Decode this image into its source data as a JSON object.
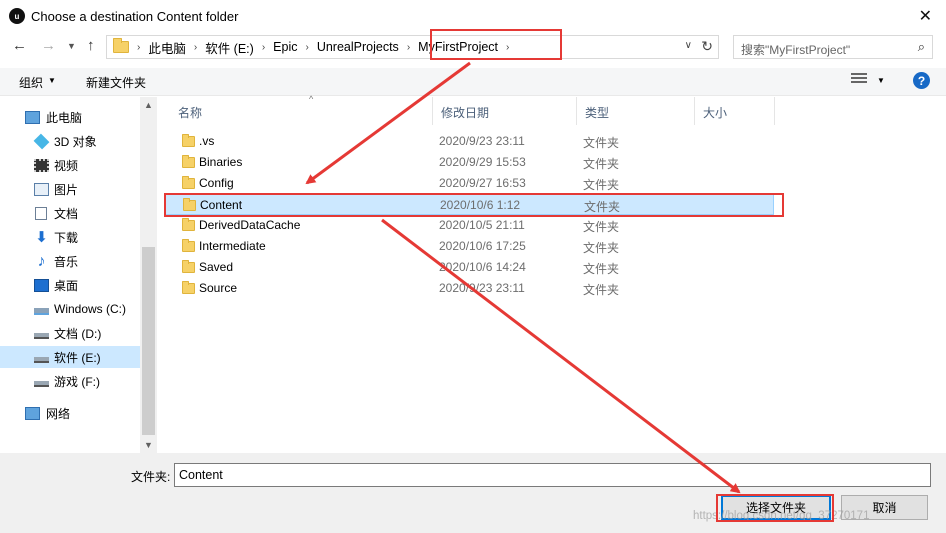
{
  "window": {
    "title": "Choose a destination Content folder",
    "logo": "unreal-engine-logo",
    "logo_text": "u"
  },
  "address": {
    "crumbs": [
      "此电脑",
      "软件 (E:)",
      "Epic",
      "UnrealProjects",
      "MyFirstProject"
    ],
    "search_placeholder": "搜索\"MyFirstProject\""
  },
  "toolbar": {
    "organize_label": "组织",
    "new_folder_label": "新建文件夹",
    "help_label": "?"
  },
  "sidebar": {
    "items": [
      {
        "label": "此电脑",
        "icon": "computer-icon"
      },
      {
        "label": "3D 对象",
        "icon": "3d-objects-icon"
      },
      {
        "label": "视频",
        "icon": "video-icon"
      },
      {
        "label": "图片",
        "icon": "pictures-icon"
      },
      {
        "label": "文档",
        "icon": "documents-icon"
      },
      {
        "label": "下载",
        "icon": "download-icon"
      },
      {
        "label": "音乐",
        "icon": "music-icon"
      },
      {
        "label": "桌面",
        "icon": "desktop-icon"
      },
      {
        "label": "Windows (C:)",
        "icon": "windows-drive-icon"
      },
      {
        "label": "文档 (D:)",
        "icon": "drive-icon"
      },
      {
        "label": "软件 (E:)",
        "icon": "drive-icon",
        "selected": true
      },
      {
        "label": "游戏 (F:)",
        "icon": "drive-icon"
      },
      {
        "label": "网络",
        "icon": "network-icon"
      }
    ]
  },
  "filelist": {
    "columns": [
      "名称",
      "修改日期",
      "类型",
      "大小"
    ],
    "rows": [
      {
        "name": ".vs",
        "date": "2020/9/23 23:11",
        "type": "文件夹"
      },
      {
        "name": "Binaries",
        "date": "2020/9/29 15:53",
        "type": "文件夹"
      },
      {
        "name": "Config",
        "date": "2020/9/27 16:53",
        "type": "文件夹"
      },
      {
        "name": "Content",
        "date": "2020/10/6 1:12",
        "type": "文件夹",
        "selected": true
      },
      {
        "name": "DerivedDataCache",
        "date": "2020/10/5 21:11",
        "type": "文件夹"
      },
      {
        "name": "Intermediate",
        "date": "2020/10/6 17:25",
        "type": "文件夹"
      },
      {
        "name": "Saved",
        "date": "2020/10/6 14:24",
        "type": "文件夹"
      },
      {
        "name": "Source",
        "date": "2020/9/23 23:11",
        "type": "文件夹"
      }
    ]
  },
  "footer": {
    "folder_label": "文件夹:",
    "folder_value": "Content",
    "select_button": "选择文件夹",
    "cancel_button": "取消",
    "watermark": "https://blog.csdn.net/qq_37270171"
  },
  "colors": {
    "selection": "#cce8ff",
    "annotation": "#e53935",
    "accent": "#0078d7"
  }
}
